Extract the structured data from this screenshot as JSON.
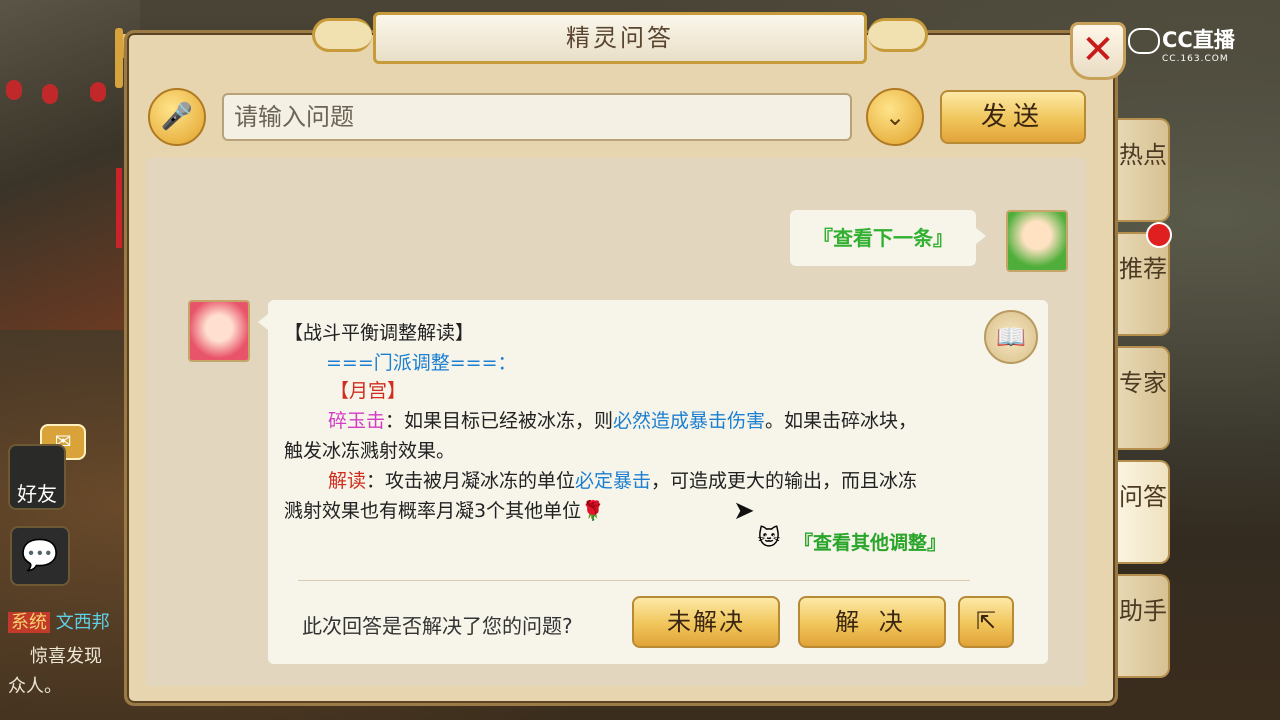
{
  "window": {
    "title": "精灵问答",
    "close_label": "✕"
  },
  "branding": {
    "logo_text": "CC直播",
    "logo_sub": "CC.163.COM"
  },
  "input": {
    "placeholder": "请输入问题",
    "value": "",
    "send_label": "发送"
  },
  "chat": {
    "user_message": "『查看下一条』",
    "answer": {
      "heading": "【战斗平衡调整解读】",
      "section": "===门派调整===：",
      "school": "【月宫】",
      "skill_name": "碎玉击",
      "skill_text_1": "：如果目标已经被冰冻，则",
      "skill_highlight": "必然造成暴击伤害",
      "skill_text_2": "。如果击碎冰块，",
      "skill_text_3": "触发冰冻溅射效果。",
      "explain_label": "解读",
      "explain_text_1": "：攻击被月凝冰冻的单位",
      "explain_highlight": "必定暴击",
      "explain_text_2": "，可造成更大的输出，而且冰冻",
      "explain_text_3": "溅射效果也有概率月凝3个其他单位",
      "more_link": "『查看其他调整』"
    },
    "feedback": {
      "question": "此次回答是否解决了您的问题?",
      "unsolved_label": "未解决",
      "solved_label": "解 决"
    }
  },
  "side_tabs": [
    {
      "label": "热点"
    },
    {
      "label": "推荐"
    },
    {
      "label": "专家"
    },
    {
      "label": "问答"
    },
    {
      "label": "助手"
    }
  ],
  "game_ui": {
    "friends_label": "好友",
    "chat_tag": "系统",
    "chat_name": "文西邦",
    "chat_line_2": "惊喜发现",
    "chat_line_3": "众人。"
  },
  "colors": {
    "accent_gold": "#f0c55a",
    "link_green": "#29a52a",
    "link_blue": "#1c7fd0",
    "alert_red": "#d12d1f"
  }
}
